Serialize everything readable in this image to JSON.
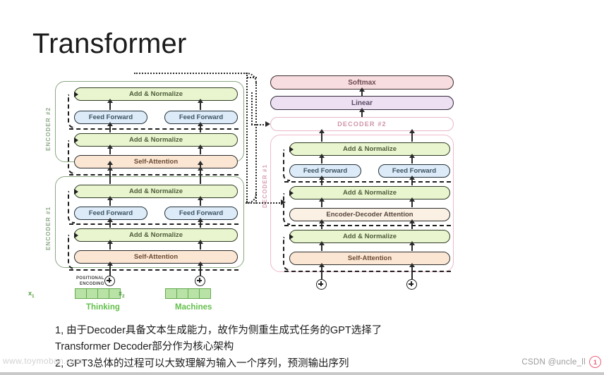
{
  "slide": {
    "title": "Transformer",
    "background": "#ffffff"
  },
  "diagram": {
    "encoder_stack": {
      "groups": [
        {
          "id": "encoder2",
          "label": "ENCODER #2"
        },
        {
          "id": "encoder1",
          "label": "ENCODER #1"
        }
      ],
      "layer_labels": {
        "add_normalize": "Add & Normalize",
        "feed_forward": "Feed Forward",
        "self_attention": "Self-Attention"
      }
    },
    "decoder_stack": {
      "groups": [
        {
          "id": "decoder2",
          "label": "DECODER #2"
        },
        {
          "id": "decoder1",
          "label": "DECODER #1"
        }
      ],
      "layer_labels": {
        "add_normalize": "Add & Normalize",
        "feed_forward": "Feed Forward",
        "encoder_decoder_attention": "Encoder-Decoder Attention",
        "self_attention": "Self-Attention"
      },
      "output_head": {
        "softmax": "Softmax",
        "linear": "Linear"
      }
    },
    "positional_encoding": {
      "label_line1": "POSITIONAL",
      "label_line2": "ENCODING",
      "operator": "+"
    },
    "embeddings": [
      {
        "symbol": "x",
        "subscript": "1",
        "word": "Thinking",
        "cells": 4
      },
      {
        "symbol": "x",
        "subscript": "2",
        "word": "Machines",
        "cells": 4
      }
    ],
    "colors": {
      "add_normalize": "#e9f5cf",
      "feed_forward": "#dcebf7",
      "self_attention": "#fbe6d4",
      "encoder_decoder_attention": "#fbf0e4",
      "softmax": "#f8dde0",
      "linear": "#ece0f2",
      "encoder_border": "#8aa882",
      "decoder_border": "#edb9cc",
      "embedding_cell": "#b9e3a6",
      "word_text": "#62bf4a"
    }
  },
  "caption": {
    "line1": "1, 由于Decoder具备文本生成能力，故作为侧重生成式任务的GPT选择了",
    "line2": "Transformer Decoder部分作为核心架构",
    "line3": "2, GPT3总体的过程可以大致理解为输入一个序列，预测输出序列"
  },
  "watermarks": {
    "left": "www.toymoban.com",
    "right": "CSDN @uncle_ll",
    "badge": "1"
  }
}
